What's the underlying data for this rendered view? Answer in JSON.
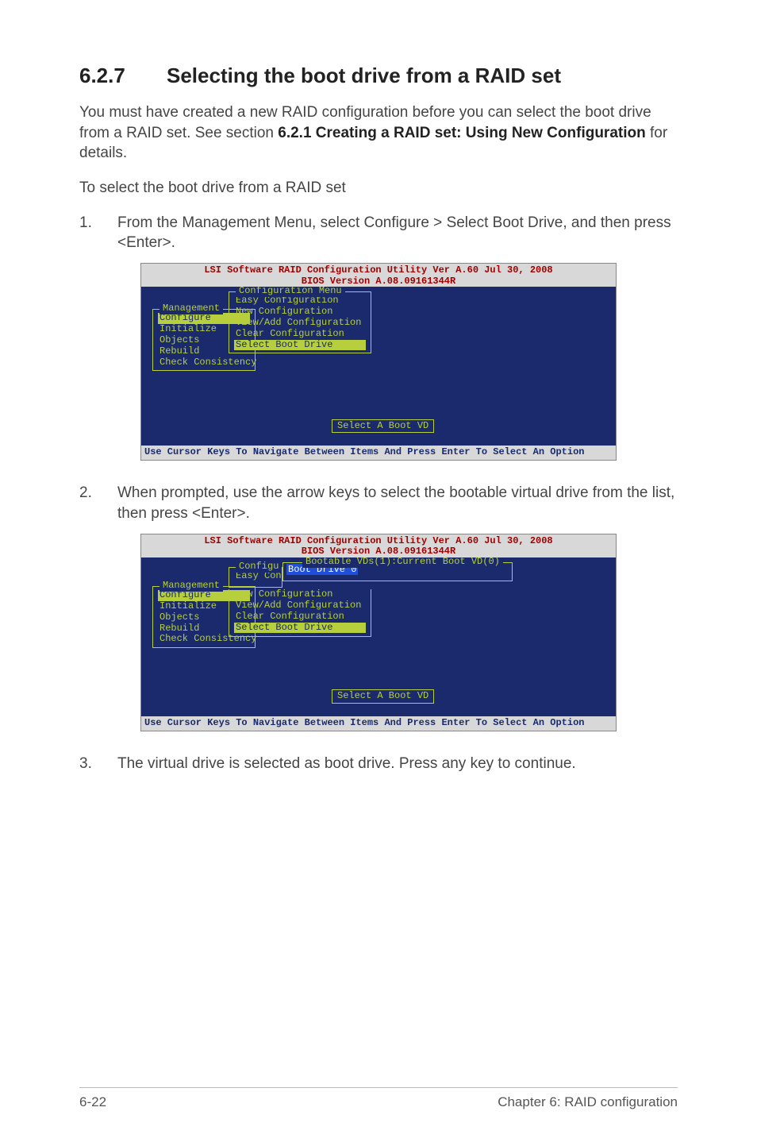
{
  "heading": {
    "number": "6.2.7",
    "title": "Selecting the boot drive from a RAID set"
  },
  "intro": {
    "p1_pre": "You must have created a new RAID configuration before you can select the boot drive from a RAID set. See section ",
    "p1_bold": "6.2.1 Creating a RAID set: Using New Configuration",
    "p1_post": " for details.",
    "p2": "To select the boot drive from a RAID set"
  },
  "steps": {
    "s1_num": "1.",
    "s1_pre": "From the ",
    "s1_b1": "Management Menu",
    "s1_mid1": ", select ",
    "s1_b2": "Configure",
    "s1_mid2": " > ",
    "s1_b3": "Select Boot Drive",
    "s1_post": ", and then press <Enter>.",
    "s2_num": "2.",
    "s2_text": "When prompted, use the arrow keys to select the bootable virtual drive from the list, then press <Enter>.",
    "s3_num": "3.",
    "s3_text": "The virtual drive is selected as boot drive. Press any key to continue."
  },
  "bios_common": {
    "header_l1": "LSI Software RAID Configuration Utility Ver A.60 Jul 30, 2008",
    "header_l2": "BIOS Version   A.08.09161344R",
    "footer": "Use Cursor Keys To Navigate Between Items And Press Enter To Select An Option",
    "bottom_msg": "Select A Boot VD",
    "mgmt_legend": "Management",
    "cfg_legend": "Configuration Menu",
    "mgmt_items": {
      "configure": "Configure",
      "initialize": "Initialize",
      "objects": "Objects",
      "rebuild": "Rebuild",
      "check": "Check Consistency"
    },
    "cfg_items": {
      "easy": "Easy Configuration",
      "newc": "New Configuration",
      "view": "View/Add Configuration",
      "clear": "Clear Configuration",
      "select": "Select Boot Drive"
    }
  },
  "bios2": {
    "configu_label": "Configu",
    "easy_con_label": "Easy Con",
    "bootable_legend": "Bootable VDs(1):Current Boot VD(0)",
    "boot_drive": "Boot Drive 0"
  },
  "footer": {
    "left": "6-22",
    "right": "Chapter 6: RAID configuration"
  }
}
